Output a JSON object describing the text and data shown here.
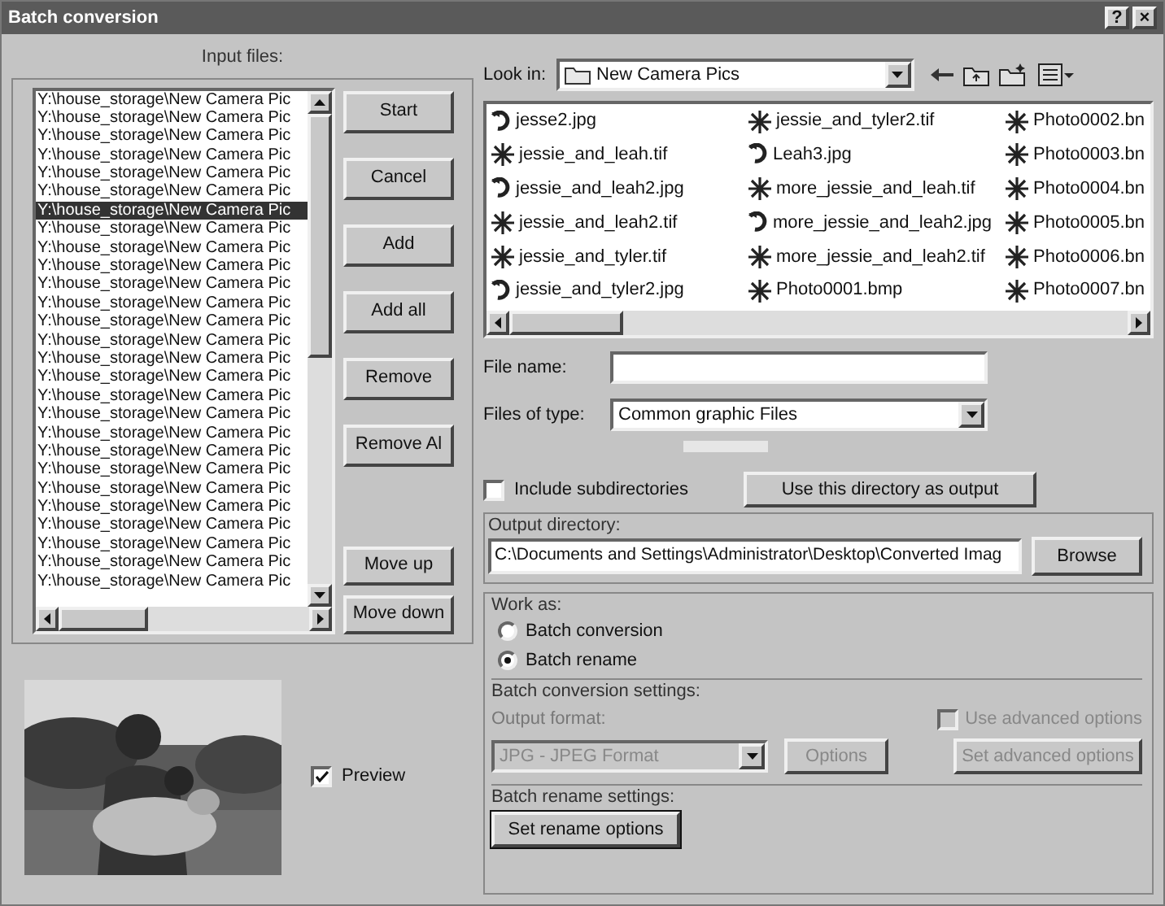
{
  "window": {
    "title": "Batch conversion",
    "buttons": [
      "?",
      "×"
    ]
  },
  "input_files": {
    "label": "Input files:",
    "items": [
      {
        "text": "Y:\\house_storage\\New Camera Pic",
        "selected": false
      },
      {
        "text": "Y:\\house_storage\\New Camera Pic",
        "selected": false
      },
      {
        "text": "Y:\\house_storage\\New Camera Pic",
        "selected": false
      },
      {
        "text": "Y:\\house_storage\\New Camera Pic",
        "selected": false
      },
      {
        "text": "Y:\\house_storage\\New Camera Pic",
        "selected": false
      },
      {
        "text": "Y:\\house_storage\\New Camera Pic",
        "selected": false
      },
      {
        "text": "Y:\\house_storage\\New Camera Pic",
        "selected": true
      },
      {
        "text": "Y:\\house_storage\\New Camera Pic",
        "selected": false
      },
      {
        "text": "Y:\\house_storage\\New Camera Pic",
        "selected": false
      },
      {
        "text": "Y:\\house_storage\\New Camera Pic",
        "selected": false
      },
      {
        "text": "Y:\\house_storage\\New Camera Pic",
        "selected": false
      },
      {
        "text": "Y:\\house_storage\\New Camera Pic",
        "selected": false
      },
      {
        "text": "Y:\\house_storage\\New Camera Pic",
        "selected": false
      },
      {
        "text": "Y:\\house_storage\\New Camera Pic",
        "selected": false
      },
      {
        "text": "Y:\\house_storage\\New Camera Pic",
        "selected": false
      },
      {
        "text": "Y:\\house_storage\\New Camera Pic",
        "selected": false
      },
      {
        "text": "Y:\\house_storage\\New Camera Pic",
        "selected": false
      },
      {
        "text": "Y:\\house_storage\\New Camera Pic",
        "selected": false
      },
      {
        "text": "Y:\\house_storage\\New Camera Pic",
        "selected": false
      },
      {
        "text": "Y:\\house_storage\\New Camera Pic",
        "selected": false
      },
      {
        "text": "Y:\\house_storage\\New Camera Pic",
        "selected": false
      },
      {
        "text": "Y:\\house_storage\\New Camera Pic",
        "selected": false
      },
      {
        "text": "Y:\\house_storage\\New Camera Pic",
        "selected": false
      },
      {
        "text": "Y:\\house_storage\\New Camera Pic",
        "selected": false
      },
      {
        "text": "Y:\\house_storage\\New Camera Pic",
        "selected": false
      },
      {
        "text": "Y:\\house_storage\\New Camera Pic",
        "selected": false
      },
      {
        "text": "Y:\\house_storage\\New Camera Pic",
        "selected": false
      }
    ]
  },
  "list_buttons": [
    "Start",
    "Cancel",
    "Add",
    "Add all",
    "Remove",
    "Remove Al"
  ],
  "order_buttons": [
    "Move up",
    "Move down"
  ],
  "preview": {
    "label": "Preview",
    "checked": true
  },
  "look_in": {
    "label": "Look in:",
    "value": "New Camera Pics"
  },
  "files": [
    {
      "name": "jesse2.jpg",
      "kind": "jpg"
    },
    {
      "name": "jessie_and_leah.tif"
    },
    {
      "name": "jessie_and_leah2.jpg",
      "kind": "jpg"
    },
    {
      "name": "jessie_and_leah2.tif"
    },
    {
      "name": "jessie_and_tyler.tif"
    },
    {
      "name": "jessie_and_tyler2.jpg",
      "kind": "jpg"
    },
    {
      "name": "jessie_and_tyler2.tif"
    },
    {
      "name": "Leah3.jpg",
      "kind": "jpg"
    },
    {
      "name": "more_jessie_and_leah.tif"
    },
    {
      "name": "more_jessie_and_leah2.jpg",
      "kind": "jpg"
    },
    {
      "name": "more_jessie_and_leah2.tif"
    },
    {
      "name": "Photo0001.bmp"
    },
    {
      "name": "Photo0002.bn"
    },
    {
      "name": "Photo0003.bn"
    },
    {
      "name": "Photo0004.bn"
    },
    {
      "name": "Photo0005.bn"
    },
    {
      "name": "Photo0006.bn"
    },
    {
      "name": "Photo0007.bn"
    }
  ],
  "file_name": {
    "label": "File name:"
  },
  "files_of_type": {
    "label": "Files of type:",
    "value": "Common graphic Files"
  },
  "include_subdirectories": {
    "label": "Include subdirectories",
    "checked": false
  },
  "use_directory_button": "Use this directory as output",
  "output_directory": {
    "label": "Output directory:",
    "value": "C:\\Documents and Settings\\Administrator\\Desktop\\Converted Imag",
    "button": "Browse"
  },
  "work_as": {
    "label": "Work as:",
    "options": [
      {
        "label": "Batch conversion",
        "selected": false
      },
      {
        "label": "Batch rename",
        "selected": true
      }
    ]
  },
  "conversion_settings": {
    "label": "Batch conversion settings:",
    "disabled": true,
    "output_format_label": "Output format:",
    "output_format": "JPG - JPEG Format",
    "options_button": "Options",
    "advanced_checkbox": {
      "label": "Use advanced options",
      "checked": false
    },
    "advanced_button": "Set advanced options"
  },
  "rename_settings": {
    "label": "Batch rename settings:",
    "button": "Set rename options"
  }
}
